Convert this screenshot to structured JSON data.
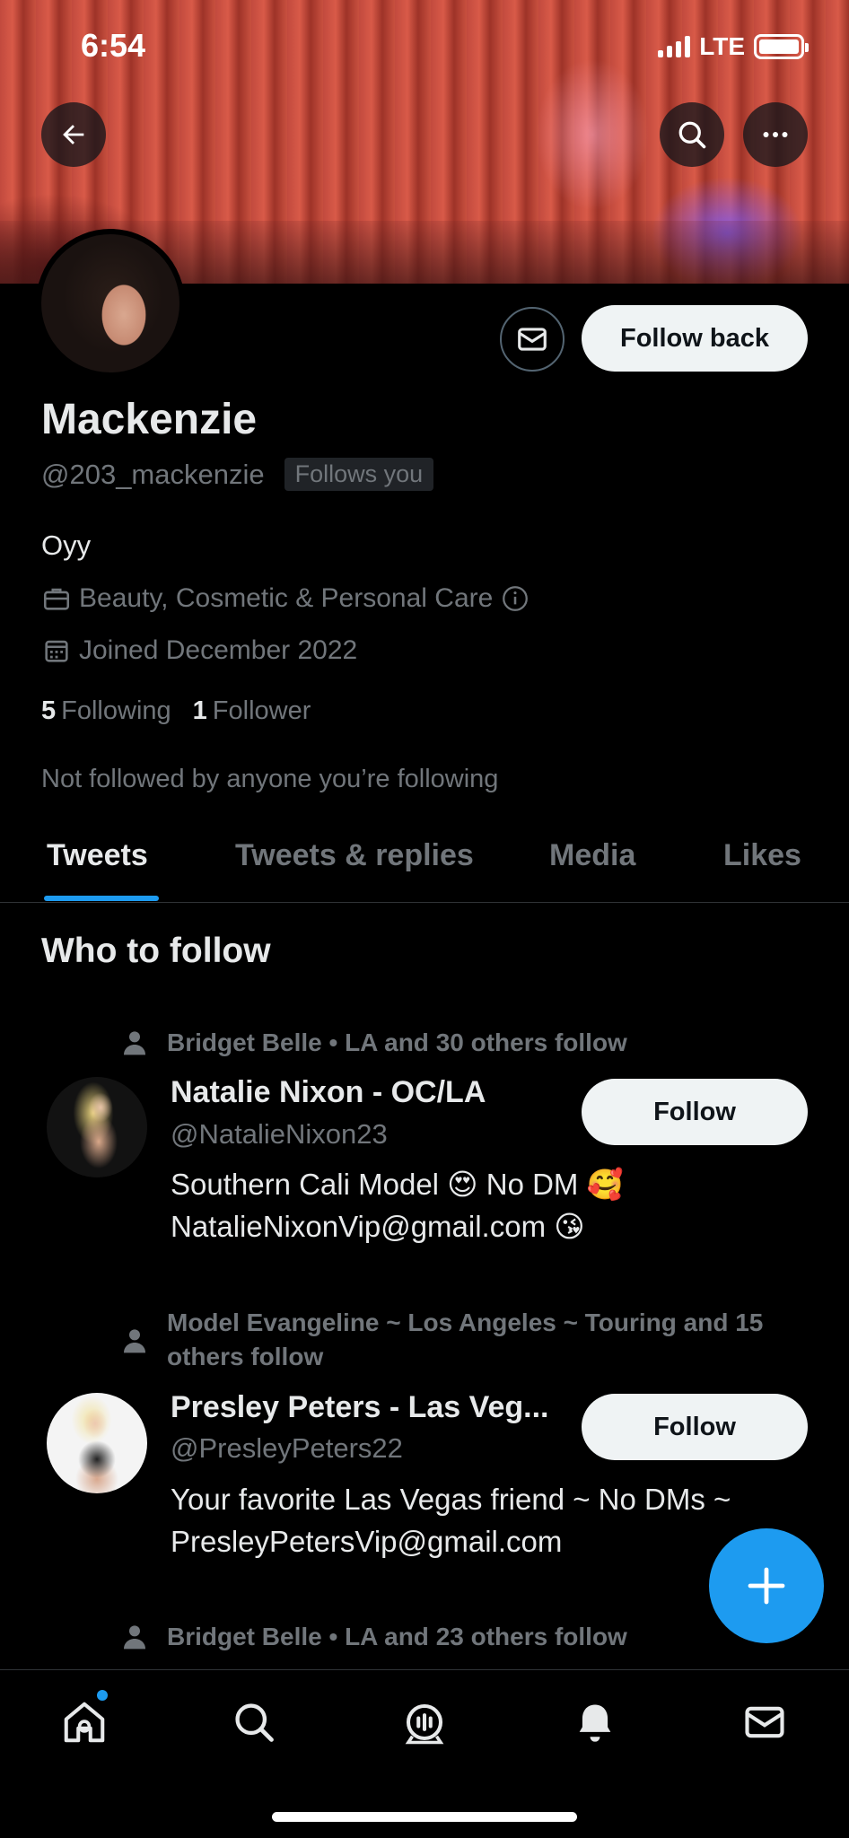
{
  "status_bar": {
    "time": "6:54",
    "network": "LTE"
  },
  "profile": {
    "name": "Mackenzie",
    "handle": "@203_mackenzie",
    "follows_you_badge": "Follows you",
    "bio": "Oyy",
    "category": "Beauty, Cosmetic & Personal Care",
    "joined": "Joined December 2022",
    "following_count": "5",
    "following_label": "Following",
    "followers_count": "1",
    "followers_label": "Follower",
    "not_followed_text": "Not followed by anyone you’re following",
    "follow_back_label": "Follow back"
  },
  "tabs": [
    {
      "label": "Tweets",
      "active": true
    },
    {
      "label": "Tweets & replies",
      "active": false
    },
    {
      "label": "Media",
      "active": false
    },
    {
      "label": "Likes",
      "active": false
    }
  ],
  "who_to_follow": {
    "title": "Who to follow",
    "suggestions": [
      {
        "social_context": "Bridget Belle • LA and 30 others follow",
        "name": "Natalie Nixon - OC/LA",
        "handle": "@NatalieNixon23",
        "bio_line1": "Southern Cali Model 😍 No DM 🥰",
        "bio_line2": "NatalieNixonVip@gmail.com 😘",
        "follow_label": "Follow"
      },
      {
        "social_context": "Model Evangeline ~ Los Angeles ~ Touring and 15 others follow",
        "name": "Presley Peters - Las Veg...",
        "handle": "@PresleyPeters22",
        "bio_line1": "Your favorite Las Vegas friend ~ No DMs ~",
        "bio_line2": "PresleyPetersVip@gmail.com",
        "follow_label": "Follow"
      },
      {
        "social_context": "Bridget Belle • LA and 23 others follow"
      }
    ]
  },
  "icons": {
    "back": "arrow-left-icon",
    "search": "search-icon",
    "more": "more-horizontal-icon",
    "message": "envelope-icon",
    "category": "briefcase-icon",
    "joined": "calendar-icon",
    "info": "info-icon",
    "person": "person-icon",
    "compose": "plus-icon",
    "nav": [
      "home-icon",
      "search-icon",
      "spaces-icon",
      "bell-icon",
      "envelope-icon"
    ]
  },
  "colors": {
    "accent": "#1d9bf0",
    "background": "#000000",
    "text_primary": "#e7e9ea",
    "text_secondary": "#71767b",
    "button_light": "#eff3f4"
  }
}
